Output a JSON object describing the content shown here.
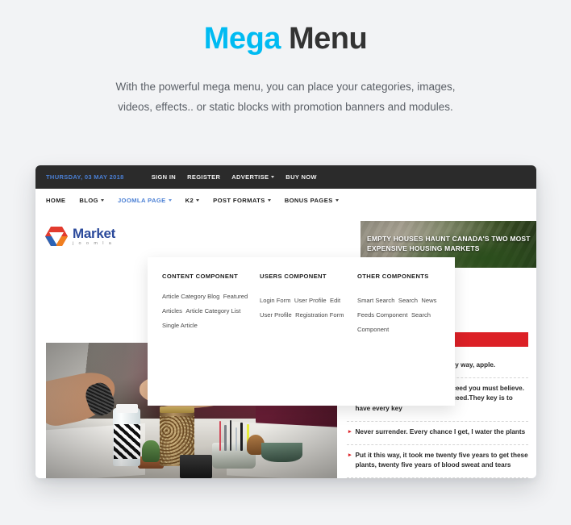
{
  "hero": {
    "title_accent": "Mega",
    "title_rest": " Menu",
    "subtitle_line1": "With the powerful mega menu, you can place your categories, images,",
    "subtitle_line2": "videos, effects.. or static blocks with promotion banners and modules."
  },
  "colors": {
    "accent": "#00bbf2",
    "topbar_bg": "#2b2b2b",
    "nav_active": "#4a7fd4",
    "red": "#dc2026",
    "page_bg": "#f2f3f5"
  },
  "site": {
    "topbar": {
      "date": "THURSDAY, 03 MAY 2018",
      "links": [
        {
          "label": "SIGN IN",
          "caret": false
        },
        {
          "label": "REGISTER",
          "caret": false
        },
        {
          "label": "ADVERTISE",
          "caret": true
        },
        {
          "label": "BUY NOW",
          "caret": false
        }
      ]
    },
    "nav": [
      {
        "label": "HOME",
        "caret": false,
        "active": false
      },
      {
        "label": "BLOG",
        "caret": true,
        "active": false
      },
      {
        "label": "JOOMLA PAGE",
        "caret": true,
        "active": true
      },
      {
        "label": "K2",
        "caret": true,
        "active": false
      },
      {
        "label": "POST FORMATS",
        "caret": true,
        "active": false
      },
      {
        "label": "BONUS PAGES",
        "caret": true,
        "active": false
      }
    ],
    "logo": {
      "name": "Market",
      "tagline": "j o o m l a"
    },
    "banner": {
      "headline": "EMPTY HOUSES HAUNT CANADA'S TWO MOST EXPENSIVE HOUSING MARKETS"
    },
    "quotes": [
      "Celebrate success right, the only way, apple.",
      "Cocoa butter is the key. To succeed you must believe. When you believe, you will succeed.They key is to have every key",
      "Never surrender. Every chance I get, I water the plants",
      "Put it this way, it took me twenty five years to get these plants, twenty five years of blood sweat and tears"
    ],
    "megamenu": {
      "columns": [
        {
          "heading": "CONTENT COMPONENT",
          "links": [
            "Article Category Blog",
            "Featured Articles",
            "Article Category List",
            "Single Article"
          ]
        },
        {
          "heading": "USERS COMPONENT",
          "links": [
            "Login Form",
            "User Profile",
            "Edit User Profile",
            "Registration Form"
          ]
        },
        {
          "heading": "OTHER COMPONENTS",
          "links": [
            "Smart Search",
            "Search",
            "News Feeds Component",
            "Search Component"
          ]
        }
      ]
    }
  }
}
